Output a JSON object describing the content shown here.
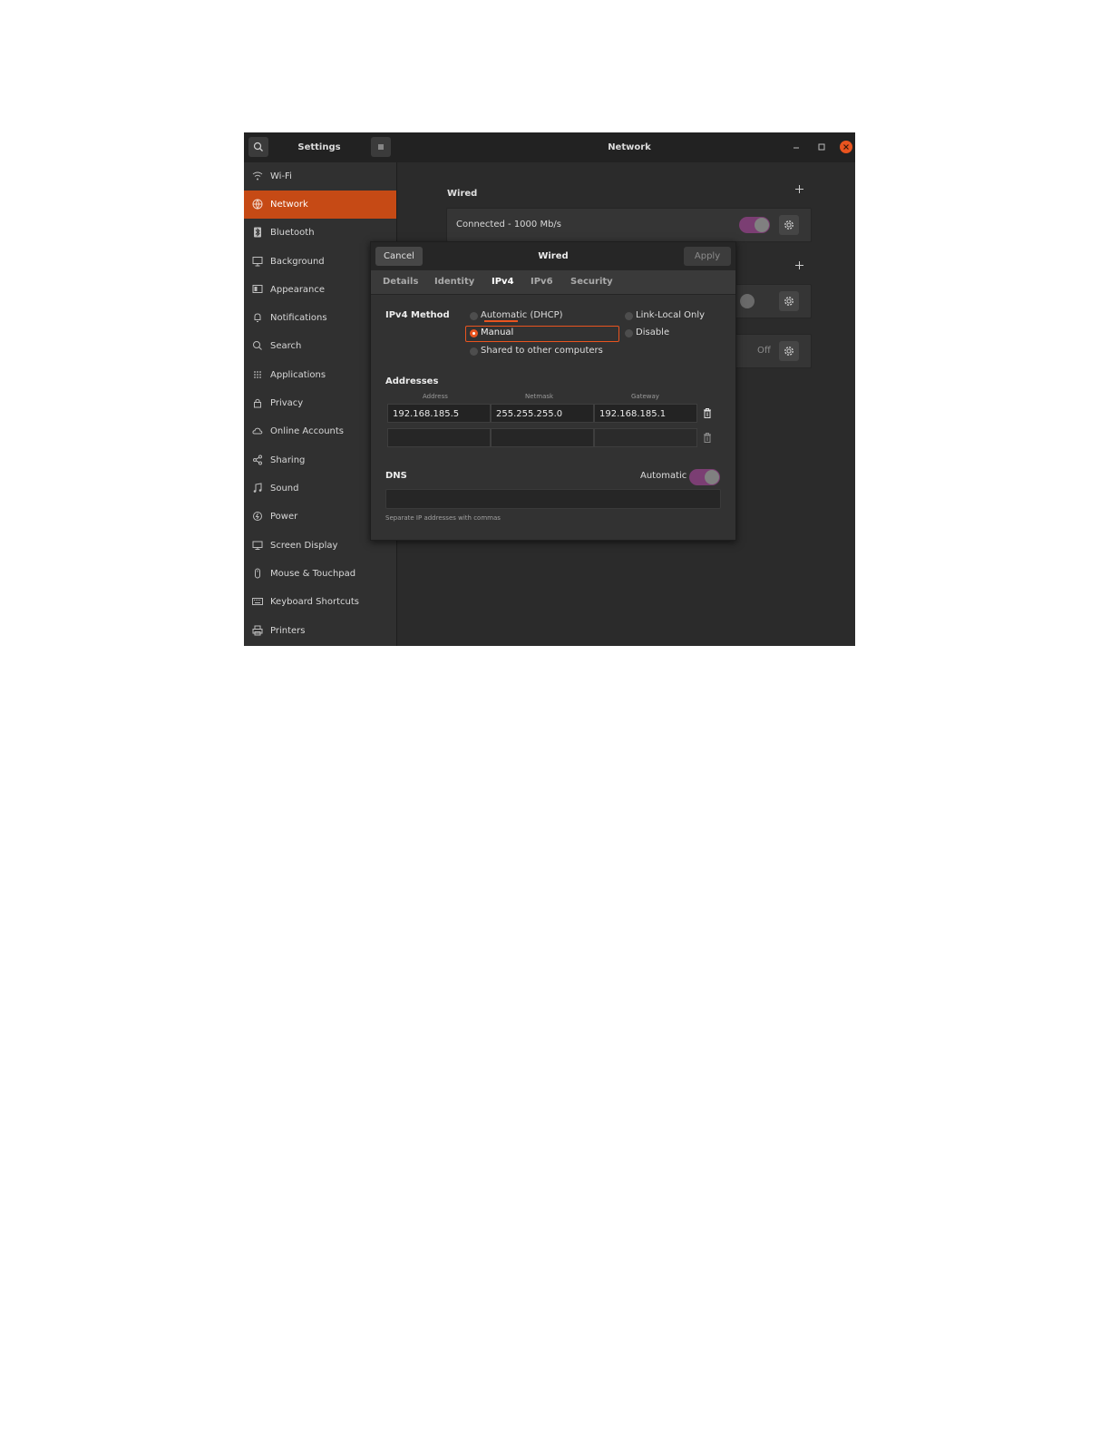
{
  "window": {
    "sidebar_title": "Settings",
    "content_title": "Network"
  },
  "sidebar": {
    "items": [
      {
        "label": "Wi-Fi",
        "icon": "wifi-icon"
      },
      {
        "label": "Network",
        "icon": "network-icon",
        "active": true
      },
      {
        "label": "Bluetooth",
        "icon": "bluetooth-icon"
      },
      {
        "label": "Background",
        "icon": "background-icon"
      },
      {
        "label": "Appearance",
        "icon": "appearance-icon"
      },
      {
        "label": "Notifications",
        "icon": "bell-icon"
      },
      {
        "label": "Search",
        "icon": "search-icon"
      },
      {
        "label": "Applications",
        "icon": "grid-icon"
      },
      {
        "label": "Privacy",
        "icon": "lock-icon"
      },
      {
        "label": "Online Accounts",
        "icon": "cloud-icon"
      },
      {
        "label": "Sharing",
        "icon": "share-icon"
      },
      {
        "label": "Sound",
        "icon": "music-icon"
      },
      {
        "label": "Power",
        "icon": "power-icon"
      },
      {
        "label": "Screen Display",
        "icon": "display-icon"
      },
      {
        "label": "Mouse & Touchpad",
        "icon": "mouse-icon"
      },
      {
        "label": "Keyboard Shortcuts",
        "icon": "keyboard-icon"
      },
      {
        "label": "Printers",
        "icon": "printer-icon"
      }
    ]
  },
  "main": {
    "wired_title": "Wired",
    "wired_status": "Connected - 1000 Mb/s",
    "vpn_off_label": "Off"
  },
  "dialog": {
    "title": "Wired",
    "cancel_label": "Cancel",
    "apply_label": "Apply",
    "tabs": [
      "Details",
      "Identity",
      "IPv4",
      "IPv6",
      "Security"
    ],
    "active_tab": "IPv4",
    "ipv4_method_label": "IPv4 Method",
    "methods": {
      "automatic": "Automatic (DHCP)",
      "manual": "Manual",
      "shared": "Shared to other computers",
      "link_local": "Link-Local Only",
      "disable": "Disable"
    },
    "selected_method": "Manual",
    "addresses_label": "Addresses",
    "columns": [
      "Address",
      "Netmask",
      "Gateway"
    ],
    "address_rows": [
      [
        "192.168.185.5",
        "255.255.255.0",
        "192.168.185.1"
      ],
      [
        "",
        "",
        ""
      ]
    ],
    "dns_label": "DNS",
    "dns_automatic_label": "Automatic",
    "dns_automatic_on": true,
    "dns_value": "",
    "dns_hint": "Separate IP addresses with commas"
  },
  "colors": {
    "accent": "#e9541f",
    "sidebar_active": "#c64a15",
    "toggle_on": "#7b3e73"
  }
}
